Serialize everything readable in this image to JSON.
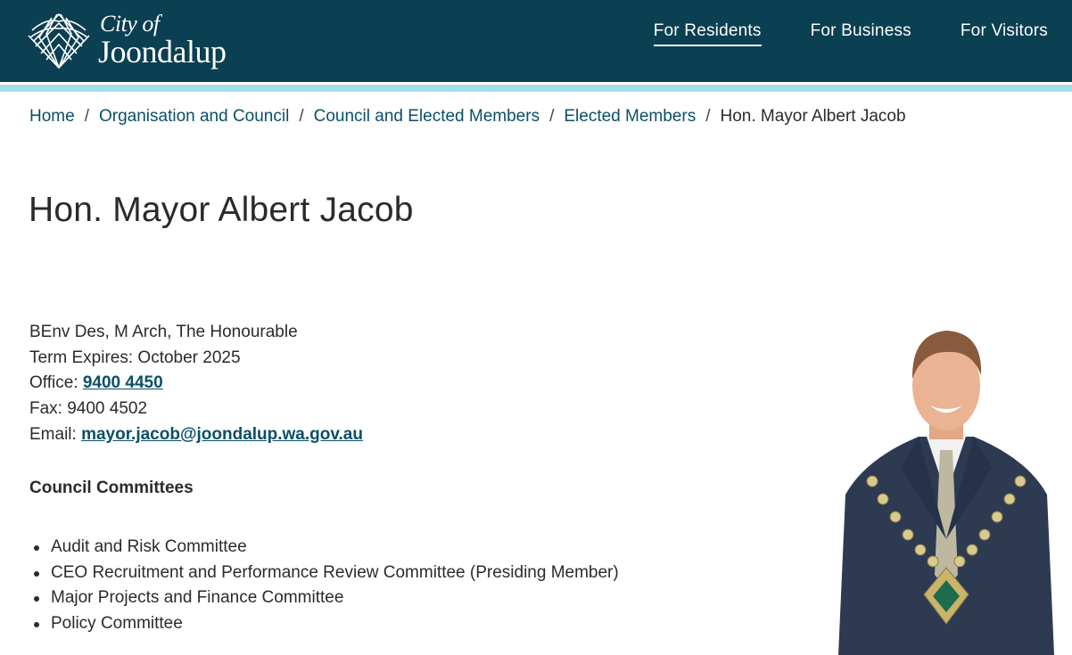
{
  "header": {
    "logo_line1": "City of",
    "logo_line2": "Joondalup",
    "nav": [
      {
        "label": "For Residents",
        "active": true
      },
      {
        "label": "For Business",
        "active": false
      },
      {
        "label": "For Visitors",
        "active": false
      }
    ]
  },
  "breadcrumb": {
    "items": [
      "Home",
      "Organisation and Council",
      "Council and Elected Members",
      "Elected Members"
    ],
    "current": "Hon. Mayor Albert Jacob",
    "separator": "/"
  },
  "page": {
    "title": "Hon. Mayor Albert Jacob"
  },
  "details": {
    "qualifications": "BEnv Des,  M Arch, The Honourable",
    "term": "Term Expires: October 2025",
    "office_label": "Office: ",
    "office_phone": "9400 4450",
    "fax": "Fax: 9400 4502",
    "email_label": "Email: ",
    "email": "mayor.jacob@joondalup.wa.gov.au"
  },
  "committees": {
    "heading": "Council Committees",
    "items": [
      "Audit and Risk Committee",
      "CEO Recruitment and Performance Review Committee (Presiding Member)",
      "Major Projects and Finance Committee",
      "Policy Committee"
    ]
  },
  "colors": {
    "header_bg": "#0b3f52",
    "stripe": "#9ee0e8",
    "link": "#0b4f67"
  }
}
